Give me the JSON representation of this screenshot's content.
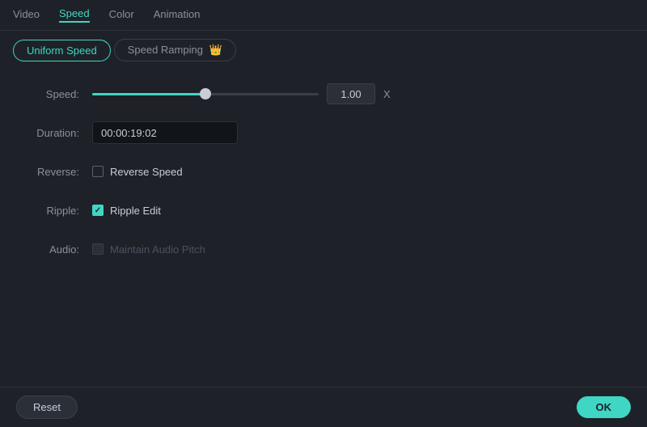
{
  "nav": {
    "tabs": [
      {
        "id": "video",
        "label": "Video",
        "active": false
      },
      {
        "id": "speed",
        "label": "Speed",
        "active": true
      },
      {
        "id": "color",
        "label": "Color",
        "active": false
      },
      {
        "id": "animation",
        "label": "Animation",
        "active": false
      }
    ]
  },
  "subTabs": [
    {
      "id": "uniform",
      "label": "Uniform Speed",
      "active": true
    },
    {
      "id": "ramping",
      "label": "Speed Ramping",
      "active": false,
      "hasIcon": true
    }
  ],
  "form": {
    "speedLabel": "Speed:",
    "speedValue": "1.00",
    "speedXLabel": "X",
    "durationLabel": "Duration:",
    "durationValue": "00:00:19:02",
    "reverseLabel": "Reverse:",
    "reverseCheckLabel": "Reverse Speed",
    "reverseChecked": false,
    "rippleLabel": "Ripple:",
    "rippleCheckLabel": "Ripple Edit",
    "rippleChecked": true,
    "audioLabel": "Audio:",
    "audioCheckLabel": "Maintain Audio Pitch",
    "audioChecked": false,
    "audioDisabled": true
  },
  "buttons": {
    "reset": "Reset",
    "ok": "OK"
  },
  "colors": {
    "accent": "#3fd6c4",
    "bg": "#1e2228",
    "inactive": "#8a9099"
  }
}
